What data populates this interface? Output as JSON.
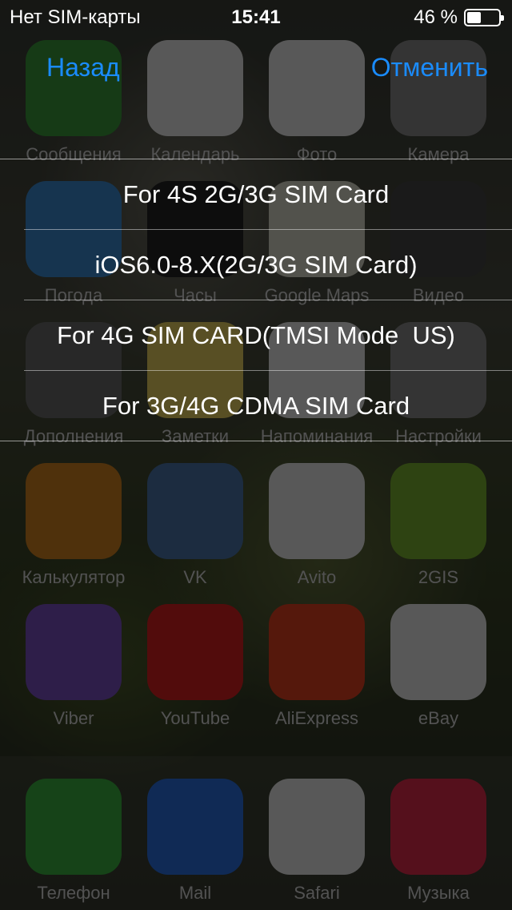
{
  "status_bar": {
    "carrier": "Нет SIM-карты",
    "time": "15:41",
    "battery": "46 %",
    "battery_level": 0.46
  },
  "nav": {
    "back_label": "Назад",
    "cancel_label": "Отменить"
  },
  "options": [
    "For 4S 2G/3G SIM Card",
    "iOS6.0-8.X(2G/3G SIM Card)",
    "For 4G SIM CARD(TMSI Mode  US)",
    "For 3G/4G CDMA SIM Card"
  ],
  "background_apps": [
    {
      "label": "Сообщения",
      "color": "#3a9a3a"
    },
    {
      "label": "Календарь",
      "color": "#e8e8e8"
    },
    {
      "label": "Фото",
      "color": "#e8e8e8"
    },
    {
      "label": "Камера",
      "color": "#8a8a8a"
    },
    {
      "label": "Погода",
      "color": "#3a8ad0"
    },
    {
      "label": "Часы",
      "color": "#222222"
    },
    {
      "label": "Google Maps",
      "color": "#d8d8c8"
    },
    {
      "label": "Видео",
      "color": "#444444"
    },
    {
      "label": "Дополнения",
      "color": "#6a6a6a"
    },
    {
      "label": "Заметки",
      "color": "#e8d060"
    },
    {
      "label": "Напоминания",
      "color": "#e8e8e8"
    },
    {
      "label": "Настройки",
      "color": "#8a8a8a"
    },
    {
      "label": "Калькулятор",
      "color": "#d08020"
    },
    {
      "label": "VK",
      "color": "#4a74a8"
    },
    {
      "label": "Avito",
      "color": "#e8e8e8"
    },
    {
      "label": "2GIS",
      "color": "#7ab030"
    },
    {
      "label": "Viber",
      "color": "#7a50c0"
    },
    {
      "label": "YouTube",
      "color": "#d82020"
    },
    {
      "label": "AliExpress",
      "color": "#e04020"
    },
    {
      "label": "eBay",
      "color": "#e8e8e8"
    },
    {
      "label": "Телефон",
      "color": "#3ab040"
    },
    {
      "label": "Mail",
      "color": "#2a70e0"
    },
    {
      "label": "Safari",
      "color": "#e8e8e8"
    },
    {
      "label": "Музыка",
      "color": "#e02a4a"
    }
  ]
}
